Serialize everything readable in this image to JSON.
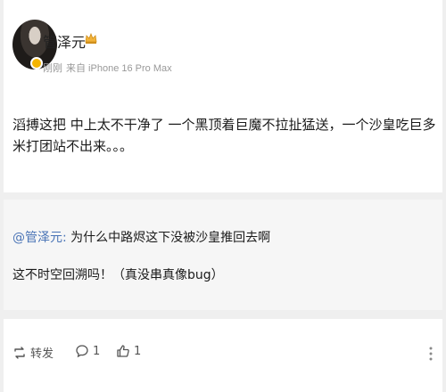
{
  "post": {
    "username": "管泽元",
    "time": "刚刚",
    "source": "来自 iPhone 16 Pro Max",
    "text": "滔搏这把 中上太不干净了 一个黑顶着巨魔不拉扯猛送，一个沙皇吃巨多米打团站不出来。。。"
  },
  "quote": {
    "mention": "@管泽元:",
    "text": " 为什么中路烬这下没被沙皇推回去啊",
    "reply": "这不时空回溯吗！（真没串真像bug）"
  },
  "actions": {
    "repost_label": "转发",
    "comment_count": "1",
    "like_count": "1"
  },
  "icons": {
    "crown": "crown-icon",
    "repost": "repost-icon",
    "comment": "comment-icon",
    "like": "thumbs-up-icon",
    "more": "more-icon"
  },
  "colors": {
    "mention": "#4a74b6",
    "badge": "#f4b400"
  }
}
